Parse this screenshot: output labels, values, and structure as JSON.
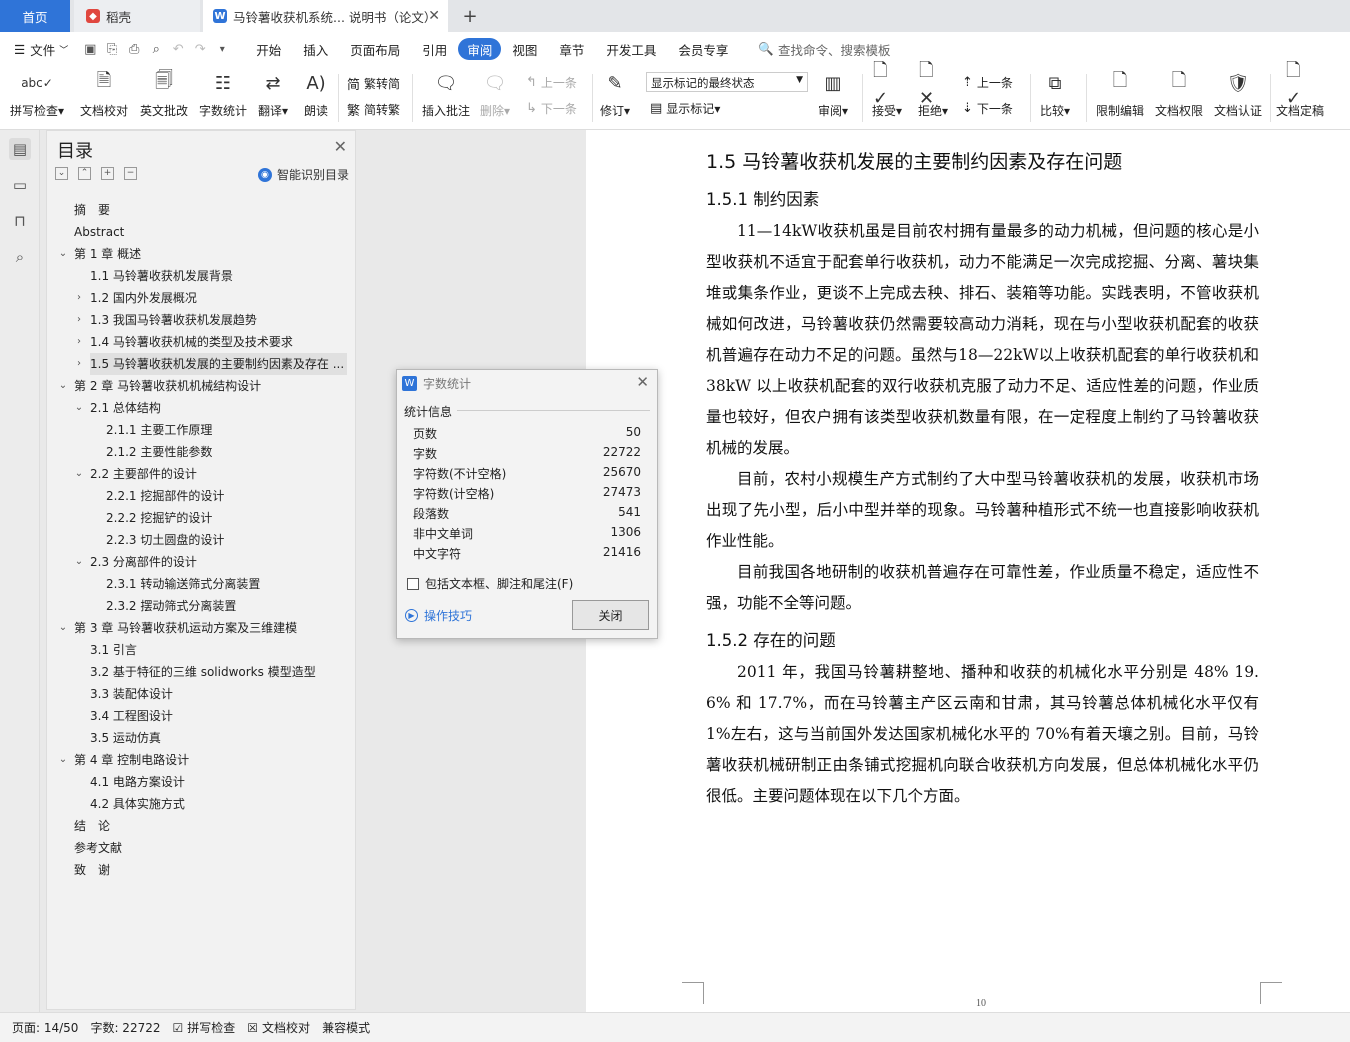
{
  "tabs": {
    "home": "首页",
    "daoke": "稻壳",
    "doc": "马铃薯收获机系统... 说明书（论文）",
    "add": "+"
  },
  "menu": {
    "file": "文件",
    "items": [
      "开始",
      "插入",
      "页面布局",
      "引用",
      "审阅",
      "视图",
      "章节",
      "开发工具",
      "会员专享"
    ],
    "active": "审阅",
    "search": "查找命令、搜索模板"
  },
  "ribbon": {
    "spell": "拼写检查",
    "proof": "文档校对",
    "en_review": "英文批改",
    "wordcount": "字数统计",
    "translate": "翻译",
    "read": "朗读",
    "trad": "繁转简",
    "simp": "简转繁",
    "insert_comment": "插入批注",
    "delete": "删除",
    "prev_c": "上一条",
    "next_c": "下一条",
    "track": "修订",
    "mark_state": "显示标记的最终状态",
    "show_mark": "显示标记",
    "review": "审阅",
    "accept": "接受",
    "reject": "拒绝",
    "prev": "上一条",
    "next": "下一条",
    "compare": "比较",
    "restrict": "限制编辑",
    "perm": "文档权限",
    "cert": "文档认证",
    "final": "文档定稿"
  },
  "toc": {
    "title": "目录",
    "smart": "智能识别目录",
    "items": [
      "摘　要",
      "Abstract",
      "第 1 章  概述",
      "1.1 马铃薯收获机发展背景",
      "1.2 国内外发展概况",
      "1.3 我国马铃薯收获机发展趋势",
      "1.4 马铃薯收获机械的类型及技术要求",
      "1.5 马铃薯收获机发展的主要制约因素及存在 ...",
      "第 2 章  马铃薯收获机机械结构设计",
      "2.1 总体结构",
      "2.1.1 主要工作原理",
      "2.1.2 主要性能参数",
      "2.2 主要部件的设计",
      "2.2.1 挖掘部件的设计",
      "2.2.2 挖掘铲的设计",
      "2.2.3 切土圆盘的设计",
      "2.3 分离部件的设计",
      "2.3.1 转动输送筛式分离装置",
      "2.3.2 摆动筛式分离装置",
      "第 3 章  马铃薯收获机运动方案及三维建模",
      "3.1 引言",
      "3.2 基于特征的三维 solidworks 模型造型",
      "3.3 装配体设计",
      "3.4 工程图设计",
      "3.5 运动仿真",
      "第 4 章  控制电路设计",
      "4.1 电路方案设计",
      "4.2 具体实施方式",
      "结　论",
      "参考文献",
      "致　谢"
    ]
  },
  "doc": {
    "h2": "1.5 马铃薯收获机发展的主要制约因素及存在问题",
    "h3a": "1.5.1 制约因素",
    "p1": "11—14kW收获机虽是目前农村拥有量最多的动力机械，但问题的核心是小型收获机不适宜于配套单行收获机，动力不能满足一次完成挖掘、分离、薯块集堆或集条作业，更谈不上完成去秧、排石、装箱等功能。实践表明，不管收获机械如何改进，马铃薯收获仍然需要较高动力消耗，现在与小型收获机配套的收获机普遍存在动力不足的问题。虽然与18—22kW以上收获机配套的单行收获机和38kW 以上收获机配套的双行收获机克服了动力不足、适应性差的问题，作业质量也较好，但农户拥有该类型收获机数量有限，在一定程度上制约了马铃薯收获机械的发展。",
    "p2": "目前，农村小规模生产方式制约了大中型马铃薯收获机的发展，收获机市场出现了先小型，后小中型并举的现象。马铃薯种植形式不统一也直接影响收获机作业性能。",
    "p3": "目前我国各地研制的收获机普遍存在可靠性差，作业质量不稳定，适应性不强，功能不全等问题。",
    "h3b": "1.5.2 存在的问题",
    "p4": "2011 年，我国马铃薯耕整地、播种和收获的机械化水平分别是 48% 19. 6% 和 17.7%，而在马铃薯主产区云南和甘肃，其马铃薯总体机械化水平仅有 1%左右，这与当前国外发达国家机械化水平的 70%有着天壤之别。目前，马铃薯收获机械研制正由条铺式挖掘机向联合收获机方向发展，但总体机械化水平仍很低。主要问题体现在以下几个方面。",
    "page_num": "10"
  },
  "dialog": {
    "title": "字数统计",
    "section": "统计信息",
    "rows": [
      {
        "k": "页数",
        "v": "50"
      },
      {
        "k": "字数",
        "v": "22722"
      },
      {
        "k": "字符数(不计空格)",
        "v": "25670"
      },
      {
        "k": "字符数(计空格)",
        "v": "27473"
      },
      {
        "k": "段落数",
        "v": "541"
      },
      {
        "k": "非中文单词",
        "v": "1306"
      },
      {
        "k": "中文字符",
        "v": "21416"
      }
    ],
    "checkbox": "包括文本框、脚注和尾注(F)",
    "tips": "操作技巧",
    "close": "关闭"
  },
  "status": {
    "page": "页面: 14/50",
    "words": "字数: 22722",
    "spell": "拼写检查",
    "proof": "文档校对",
    "compat": "兼容模式"
  },
  "colors": {
    "accent": "#2f74d8"
  }
}
